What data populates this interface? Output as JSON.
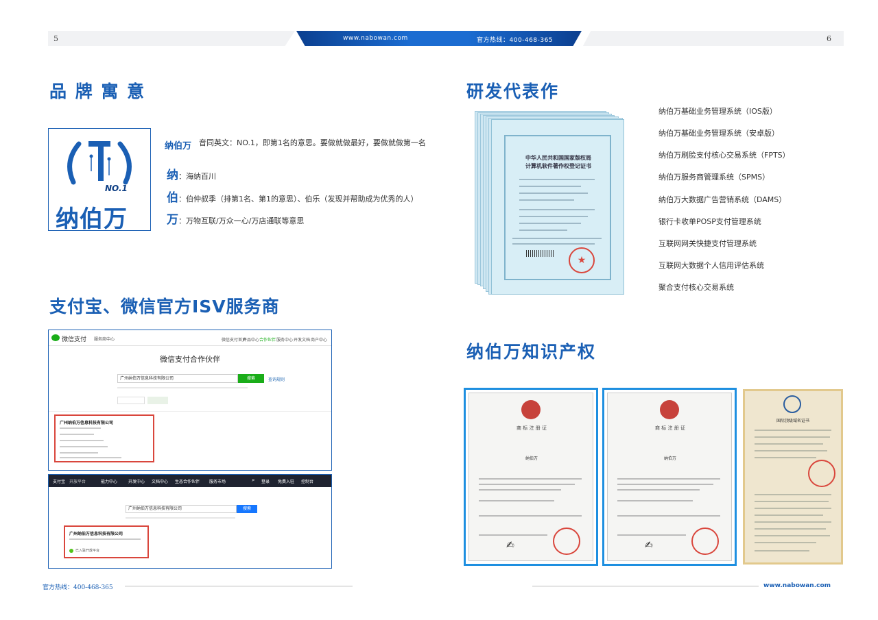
{
  "header": {
    "page_left": "5",
    "page_right": "6",
    "website": "www.nabowan.com",
    "hotline": "官方热线：400-468-365"
  },
  "brand": {
    "title": "品 牌 寓 意",
    "logo_text": "纳伯万",
    "logo_badge": "NO.1",
    "name_mark": "纳伯万",
    "intro": "音同英文：NO.1，即第1名的意思。要做就做最好，要做就做第一名",
    "items": [
      {
        "key": "纳",
        "text": "：海纳百川"
      },
      {
        "key": "伯",
        "text": "：伯仲叔季（排第1名、第1的意思）、伯乐（发现并帮助成为优秀的人）"
      },
      {
        "key": "万",
        "text": "：万物互联/万众一心/万店通联等意思"
      }
    ]
  },
  "rd": {
    "title": "研发代表作",
    "cert_title_1": "中华人民共和国国家版权局",
    "cert_title_2": "计算机软件著作权登记证书",
    "items": [
      "纳伯万基础业务管理系统（IOS版）",
      "纳伯万基础业务管理系统（安卓版）",
      "纳伯万刷脸支付核心交易系统（FPTS）",
      "纳伯万服务商管理系统（SPMS）",
      "纳伯万大数据广告营销系统（DAMS）",
      "银行卡收单POSP支付管理系统",
      "互联网网关快捷支付管理系统",
      "互联网大数据个人信用评估系统",
      "聚合支付核心交易系统"
    ]
  },
  "isv": {
    "title": "支付宝、微信官方ISV服务商",
    "wechat": {
      "logo": "微信支付",
      "sub": "服务商中心",
      "nav": [
        "微信支付首页",
        "产品中心",
        "合作伙伴",
        "服务中心",
        "开发文档",
        "商户中心"
      ],
      "heading": "微信支付合作伙伴",
      "search_value": "广州纳伯万信息科技有限公司",
      "search_button": "搜索",
      "help": "查询规则",
      "company": "广州纳伯万信息科技有限公司"
    },
    "alipay": {
      "logo": "支付宝",
      "sub": "开放平台",
      "nav": [
        "能力中心",
        "开发中心",
        "文档中心",
        "生态合作伙伴",
        "服务市场"
      ],
      "right": [
        "登录",
        "免费入驻",
        "控制台"
      ],
      "search_value": "广州纳伯万信息科技有限公司",
      "search_button": "搜索",
      "company": "广州纳伯万信息科技有限公司",
      "status": "已入驻开放平台"
    }
  },
  "ip": {
    "title": "纳伯万知识产权",
    "tm_heading": "商 标 注 册 证",
    "tm_name_1": "纳伯万",
    "tm_name_2": "纳伯万",
    "domain_heading": "国际顶级域名证书"
  },
  "footer": {
    "hotline": "官方热线：400-468-365",
    "website": "www.nabowan.com"
  },
  "colors": {
    "brand_blue": "#1a5fb4",
    "accent_blue": "#1e8fe0",
    "wechat_green": "#1aad19"
  }
}
